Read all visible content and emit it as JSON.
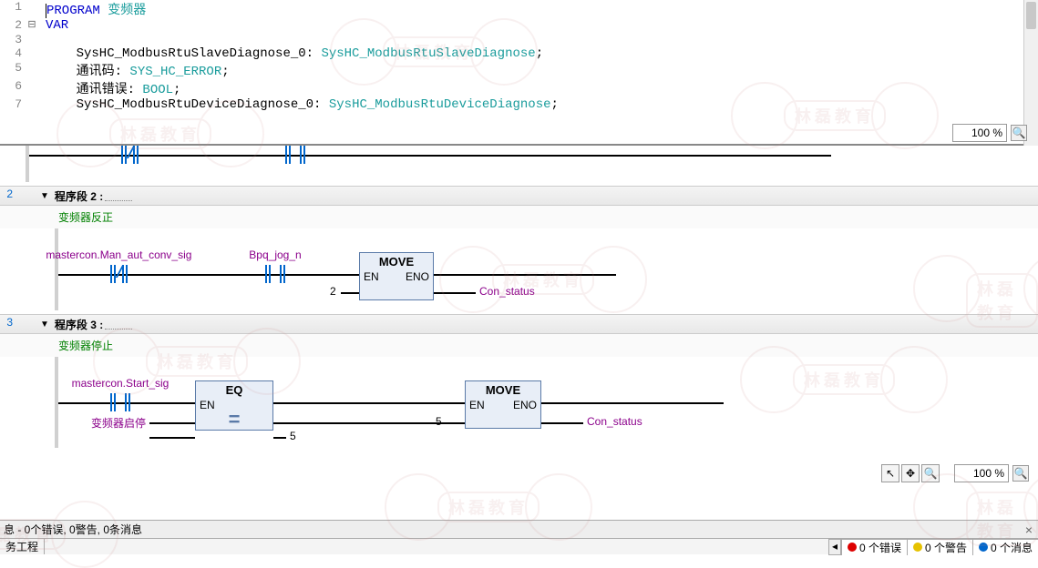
{
  "code": {
    "lines": [
      {
        "n": "1",
        "fold": "",
        "html": "<span class='cursor'></span><span class='kw'>PROGRAM</span> <span class='typ'>变频器</span>"
      },
      {
        "n": "2",
        "fold": "⊟",
        "html": "<span class='kw'>VAR</span>"
      },
      {
        "n": "3",
        "fold": "",
        "html": ""
      },
      {
        "n": "4",
        "fold": "",
        "html": "    SysHC_ModbusRtuSlaveDiagnose_0: <span class='typ'>SysHC_ModbusRtuSlaveDiagnose</span>;"
      },
      {
        "n": "5",
        "fold": "",
        "html": "    通讯码: <span class='typ'>SYS_HC_ERROR</span>;"
      },
      {
        "n": "6",
        "fold": "",
        "html": "    通讯错误: <span class='typ'>BOOL</span>;"
      },
      {
        "n": "7",
        "fold": "",
        "html": "    SysHC_ModbusRtuDeviceDiagnose_0: <span class='typ'>SysHC_ModbusRtuDeviceDiagnose</span>;"
      }
    ],
    "zoom": "100 %"
  },
  "net2": {
    "num": "2",
    "title": "程序段  2 :",
    "comment": "变频器反正",
    "contact1": "mastercon.Man_aut_conv_sig",
    "contact2": "Bpq_jog_n",
    "block": "MOVE",
    "en": "EN",
    "eno": "ENO",
    "in_val": "2",
    "out_var": "Con_status"
  },
  "net3": {
    "num": "3",
    "title": "程序段  3 :",
    "comment": "变频器停止",
    "contact1": "mastercon.Start_sig",
    "block1": "EQ",
    "en1": "EN",
    "in1_label": "变频器启停",
    "block2": "MOVE",
    "en2": "EN",
    "eno2": "ENO",
    "in2_val": "5",
    "mid_val": "5",
    "out_var": "Con_status"
  },
  "status": {
    "text": "息 - 0个错误, 0警告, 0条消息"
  },
  "tabs": {
    "left": "务工程",
    "err": "0 个错误",
    "warn": "0 个警告",
    "msg": "0 个消息"
  },
  "tools": {
    "arrow": "↖",
    "move": "✥",
    "zoom": "🔍"
  },
  "zoom2": "100 %",
  "watermark": "林磊教育"
}
